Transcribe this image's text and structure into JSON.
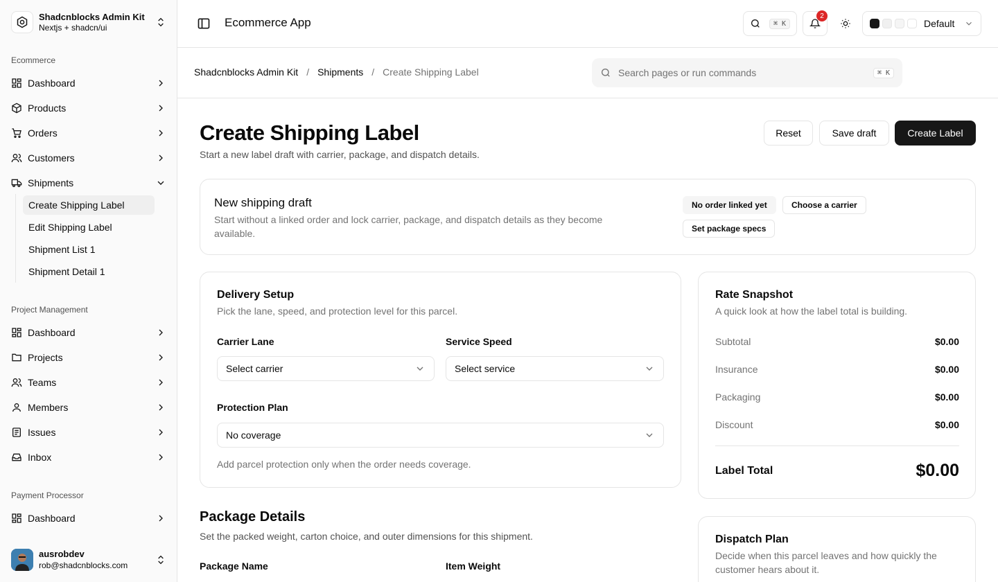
{
  "sidebar": {
    "team": {
      "name": "Shadcnblocks Admin Kit",
      "sub": "Nextjs + shadcn/ui"
    },
    "groups": [
      {
        "label": "Ecommerce"
      },
      {
        "label": "Project Management"
      },
      {
        "label": "Payment Processor"
      }
    ],
    "ecommerce_items": [
      "Dashboard",
      "Products",
      "Orders",
      "Customers",
      "Shipments"
    ],
    "shipments_sub": [
      "Create Shipping Label",
      "Edit Shipping Label",
      "Shipment List 1",
      "Shipment Detail 1"
    ],
    "pm_items": [
      "Dashboard",
      "Projects",
      "Teams",
      "Members",
      "Issues",
      "Inbox"
    ],
    "payment_items": [
      "Dashboard"
    ],
    "user": {
      "name": "ausrobdev",
      "email": "rob@shadcnblocks.com"
    }
  },
  "header": {
    "title": "Ecommerce App",
    "search_kbd": "⌘ K",
    "notif_count": "2",
    "theme_label": "Default"
  },
  "breadcrumb": {
    "root": "Shadcnblocks Admin Kit",
    "mid": "Shipments",
    "current": "Create Shipping Label",
    "sep": "/"
  },
  "search": {
    "placeholder": "Search pages or run commands",
    "kbd": "⌘ K"
  },
  "page": {
    "title": "Create Shipping Label",
    "subtitle": "Start a new label draft with carrier, package, and dispatch details.",
    "reset": "Reset",
    "save_draft": "Save draft",
    "create": "Create Label"
  },
  "draft": {
    "title": "New shipping draft",
    "desc": "Start without a linked order and lock carrier, package, and dispatch details as they become available.",
    "chips": [
      "No order linked yet",
      "Choose a carrier",
      "Set package specs"
    ]
  },
  "delivery": {
    "title": "Delivery Setup",
    "desc": "Pick the lane, speed, and protection level for this parcel.",
    "carrier_label": "Carrier Lane",
    "carrier_value": "Select carrier",
    "speed_label": "Service Speed",
    "speed_value": "Select service",
    "protection_label": "Protection Plan",
    "protection_value": "No coverage",
    "hint": "Add parcel protection only when the order needs coverage."
  },
  "rate": {
    "title": "Rate Snapshot",
    "desc": "A quick look at how the label total is building.",
    "rows": [
      {
        "k": "Subtotal",
        "v": "$0.00"
      },
      {
        "k": "Insurance",
        "v": "$0.00"
      },
      {
        "k": "Packaging",
        "v": "$0.00"
      },
      {
        "k": "Discount",
        "v": "$0.00"
      }
    ],
    "total_label": "Label Total",
    "total_value": "$0.00"
  },
  "package": {
    "title": "Package Details",
    "desc": "Set the packed weight, carton choice, and outer dimensions for this shipment.",
    "name_label": "Package Name",
    "weight_label": "Item Weight"
  },
  "dispatch": {
    "title": "Dispatch Plan",
    "desc": "Decide when this parcel leaves and how quickly the customer hears about it."
  },
  "colors": {
    "primary": "#171717",
    "badge": "#dc2626",
    "border": "#e5e5e5"
  }
}
